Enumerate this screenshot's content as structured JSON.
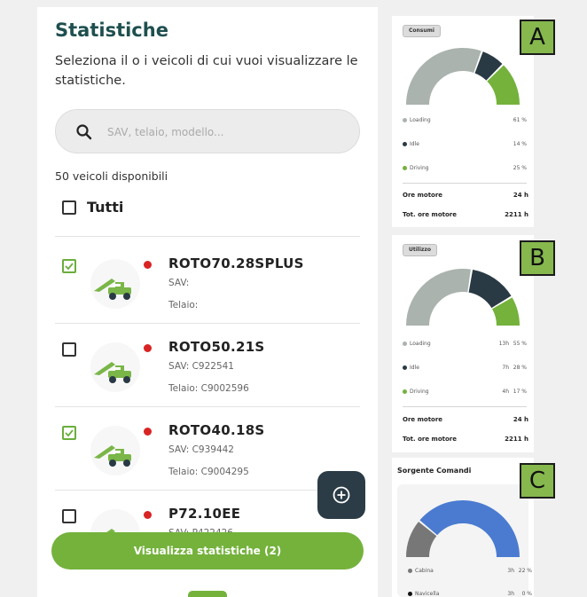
{
  "header": {
    "title": "Statistiche",
    "subtitle": "Seleziona il o i veicoli di cui vuoi visualizzare le statistiche."
  },
  "search": {
    "placeholder": "SAV, telaio, modello..."
  },
  "available_count": "50 veicoli disponibili",
  "select_all": {
    "label": "Tutti",
    "checked": false
  },
  "vehicles": [
    {
      "name": "ROTO70.28SPLUS",
      "sav": "SAV:",
      "telaio": "Telaio:",
      "checked": true
    },
    {
      "name": "ROTO50.21S",
      "sav": "SAV: C922541",
      "telaio": "Telaio: C9002596",
      "checked": false
    },
    {
      "name": "ROTO40.18S",
      "sav": "SAV: C939442",
      "telaio": "Telaio: C9004295",
      "checked": true
    },
    {
      "name": "P72.10EE",
      "sav": "SAV: P422426",
      "telaio": "",
      "checked": false
    }
  ],
  "cta": {
    "label": "Visualizza statistiche (2)"
  },
  "colors": {
    "accent_green": "#74b23c",
    "title_teal": "#1f4f4f",
    "gray_segment": "#aab3ad",
    "dark_segment": "#2a3a44",
    "blue_segment": "#4a7bd0",
    "status_red": "#d92424"
  },
  "cards": {
    "A": {
      "letter": "A",
      "pill": "Consumi",
      "legend": [
        {
          "label": "Loading",
          "value1": "",
          "value2": "61 %",
          "color": "#aab3ad"
        },
        {
          "label": "Idle",
          "value1": "",
          "value2": "14 %",
          "color": "#2a3a44"
        },
        {
          "label": "Driving",
          "value1": "",
          "value2": "25 %",
          "color": "#74b23c"
        }
      ],
      "summary": [
        {
          "label": "Ore motore",
          "value": "24 h"
        },
        {
          "label": "Tot. ore motore",
          "value": "2211 h"
        }
      ]
    },
    "B": {
      "letter": "B",
      "pill": "Utilizzo",
      "legend": [
        {
          "label": "Loading",
          "value1": "13h",
          "value2": "55 %",
          "color": "#aab3ad"
        },
        {
          "label": "Idle",
          "value1": "7h",
          "value2": "28 %",
          "color": "#2a3a44"
        },
        {
          "label": "Driving",
          "value1": "4h",
          "value2": "17 %",
          "color": "#74b23c"
        }
      ],
      "summary": [
        {
          "label": "Ore motore",
          "value": "24 h"
        },
        {
          "label": "Tot. ore motore",
          "value": "2211 h"
        }
      ]
    },
    "C": {
      "letter": "C",
      "title": "Sorgente Comandi",
      "legend": [
        {
          "label": "Cabina",
          "value1": "3h",
          "value2": "22 %",
          "color": "#777777"
        },
        {
          "label": "Navicella",
          "value1": "3h",
          "value2": "0 %",
          "color": "#111111"
        }
      ]
    }
  },
  "chart_data": [
    {
      "type": "pie",
      "title": "Consumi",
      "categories": [
        "Loading",
        "Idle",
        "Driving"
      ],
      "values": [
        61,
        14,
        25
      ],
      "unit": "%"
    },
    {
      "type": "pie",
      "title": "Utilizzo",
      "categories": [
        "Loading",
        "Idle",
        "Driving"
      ],
      "values": [
        55,
        28,
        17
      ],
      "unit": "%"
    },
    {
      "type": "pie",
      "title": "Sorgente Comandi",
      "categories": [
        "Cabina",
        "Navicella"
      ],
      "values": [
        22,
        0
      ],
      "unit": "%"
    }
  ]
}
